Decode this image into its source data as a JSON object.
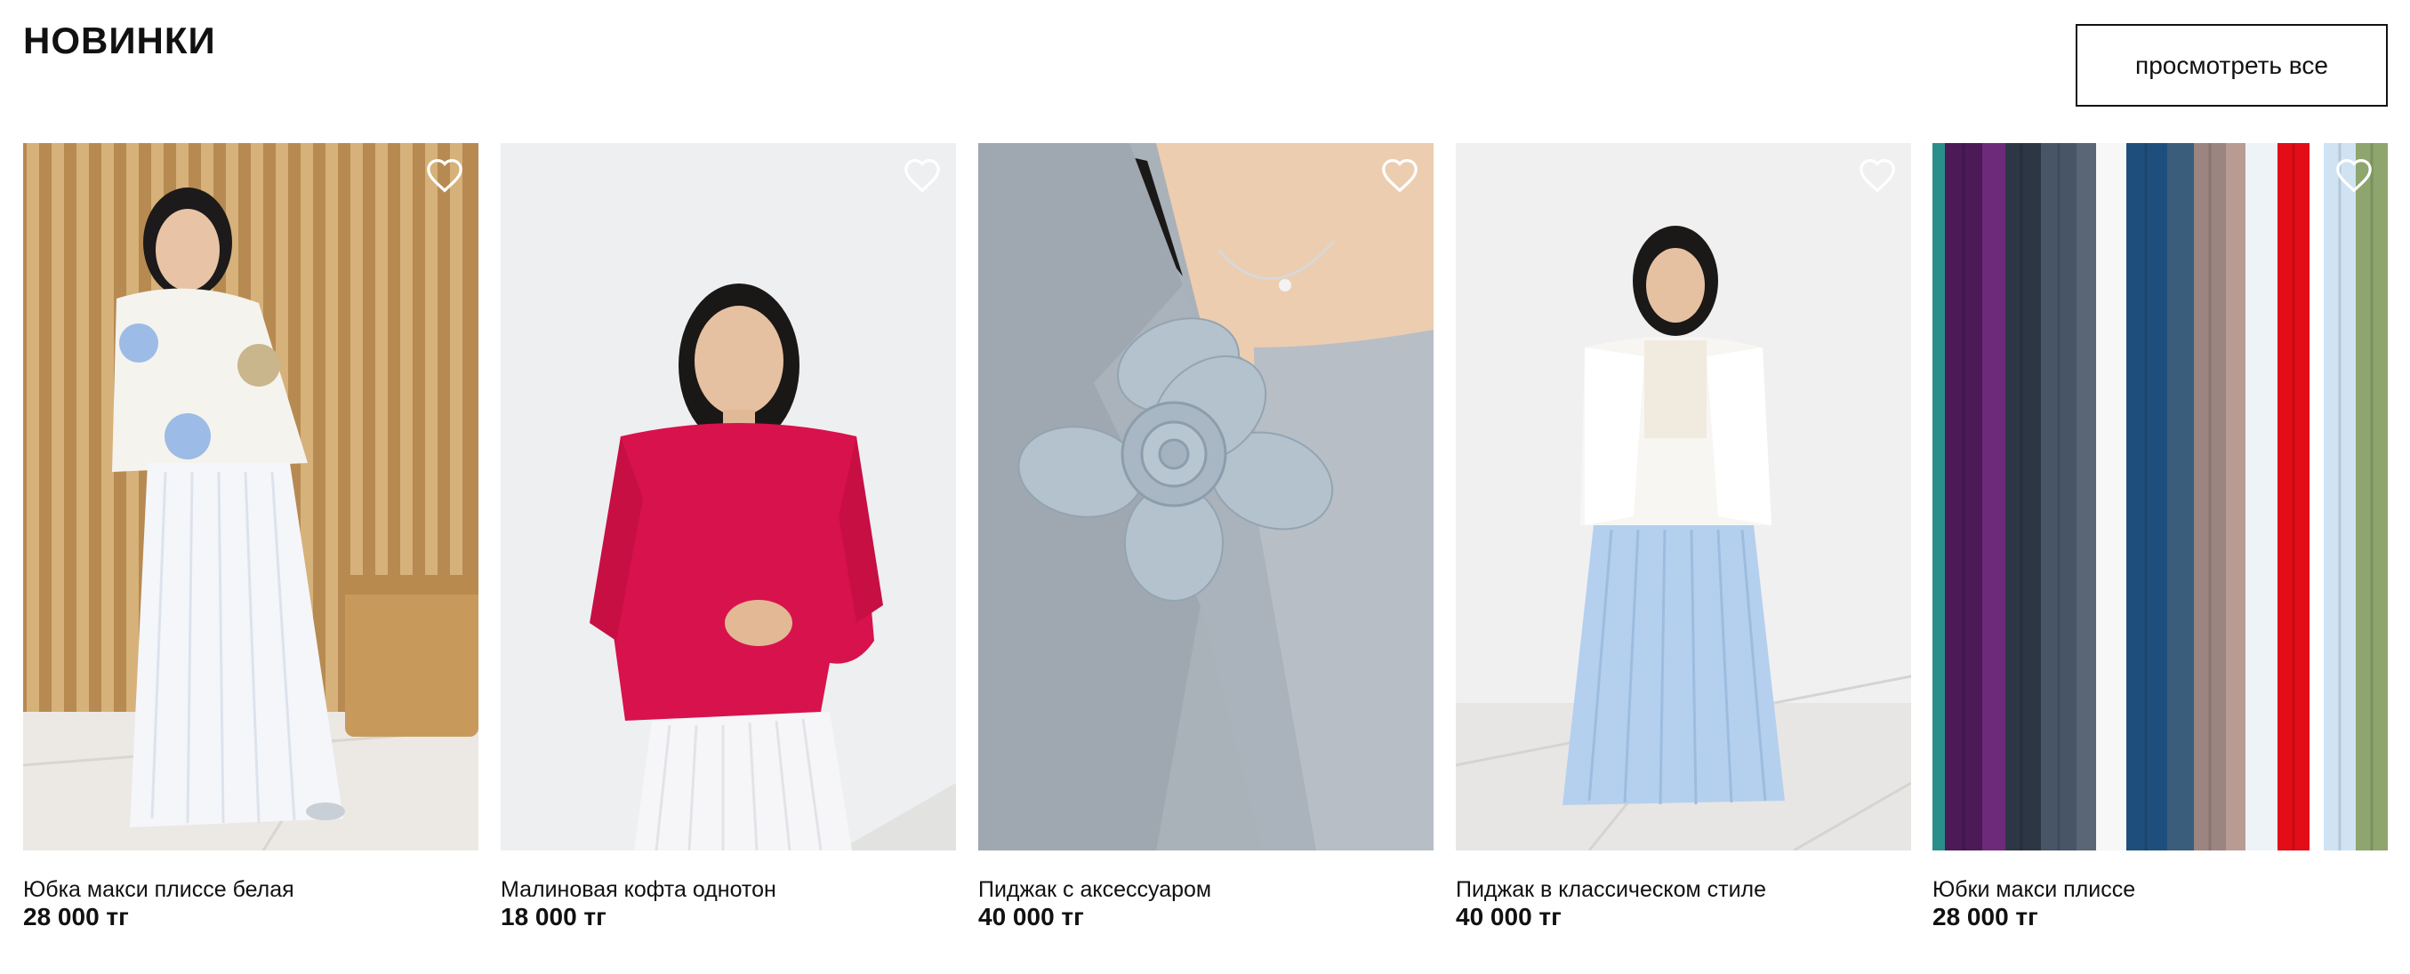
{
  "section": {
    "title": "НОВИНКИ",
    "view_all_label": "просмотреть все"
  },
  "products": [
    {
      "name": "Юбка макси плиссе белая",
      "price": "28 000 тг",
      "photo": "woman in white floral sweater and white pleated maxi skirt"
    },
    {
      "name": "Малиновая кофта однотон",
      "price": "18 000 тг",
      "photo": "woman in raspberry knit sweater"
    },
    {
      "name": "Пиджак с аксессуаром",
      "price": "40 000 тг",
      "photo": "grey blazer with fabric flower brooch"
    },
    {
      "name": "Пиджак в классическом стиле",
      "price": "40 000 тг",
      "photo": "woman in white blazer and light blue pleated skirt"
    },
    {
      "name": "Юбки макси плиссе",
      "price": "28 000 тг",
      "photo": "row of colorful pleated maxi skirts"
    }
  ],
  "icons": {
    "favorite": "heart-outline-icon"
  },
  "colors": {
    "text": "#111111",
    "background": "#ffffff",
    "button_border": "#111111",
    "heart": "#ffffff"
  }
}
